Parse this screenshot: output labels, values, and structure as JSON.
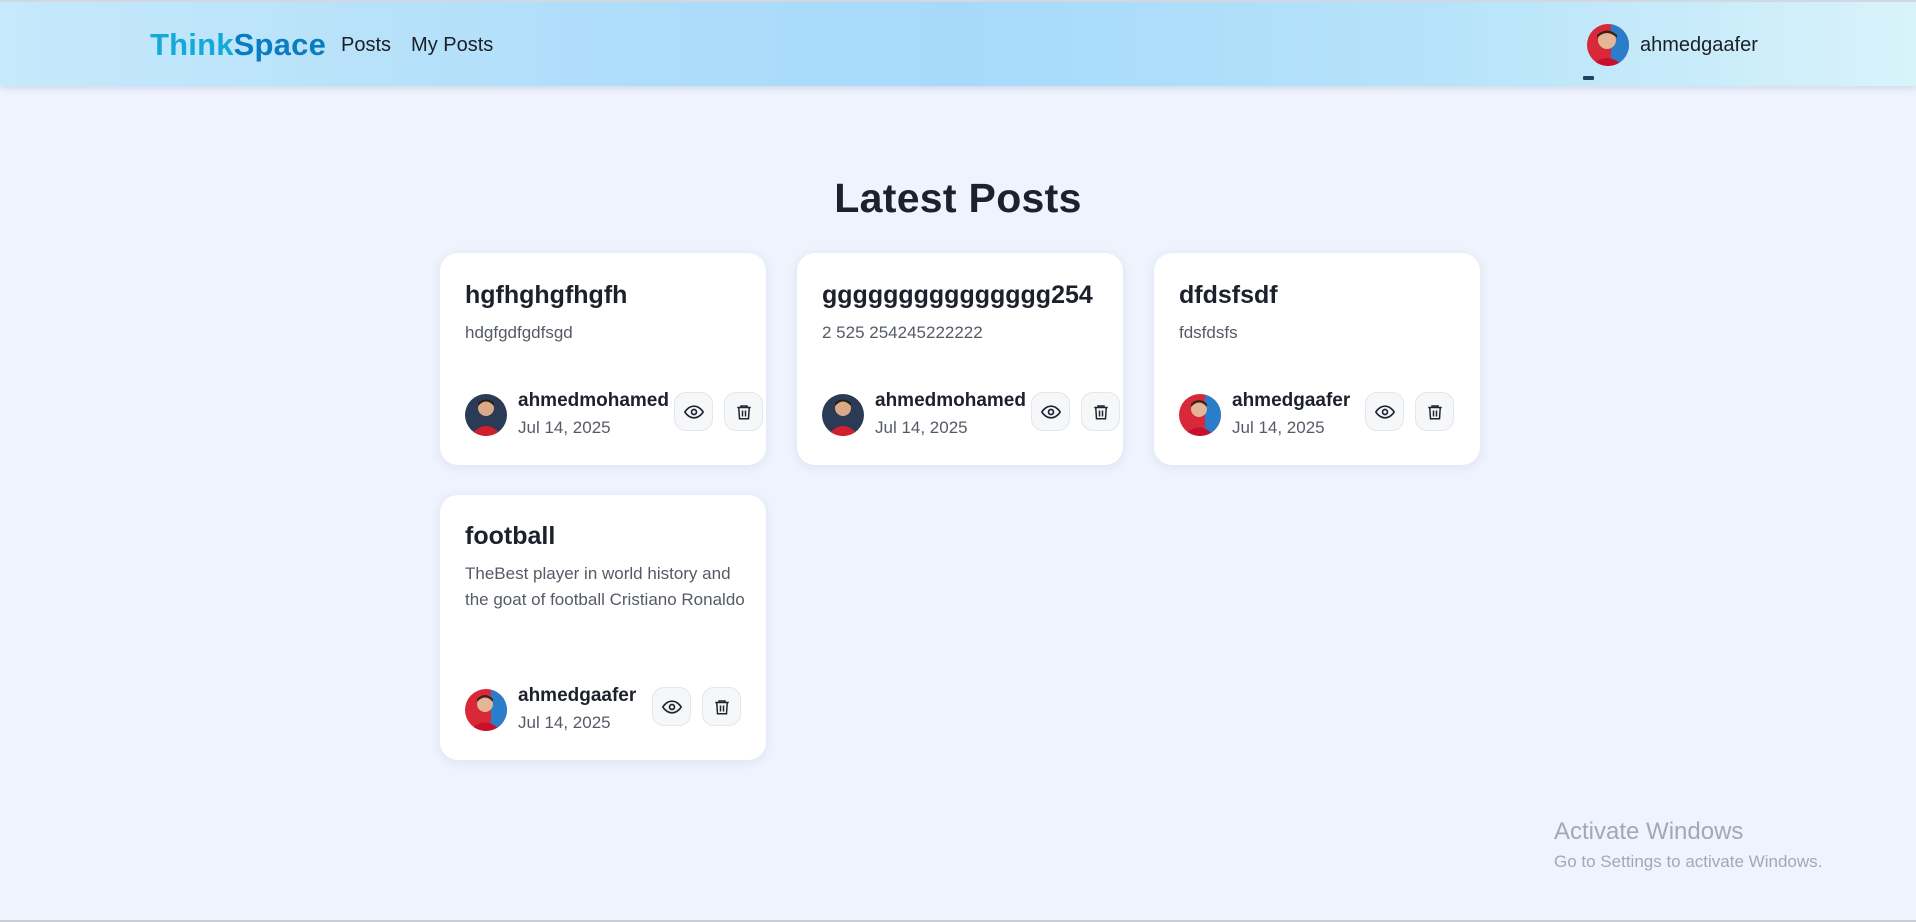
{
  "navbar": {
    "brand_part1": "Think",
    "brand_part2": "Space",
    "links": [
      "Posts",
      "My Posts"
    ],
    "user_name": "ahmedgaafer"
  },
  "page_title": "Latest Posts",
  "posts": [
    {
      "title": "hgfhghgfhgfh",
      "body": "hdgfgdfgdfsgd",
      "author": "ahmedmohamed",
      "date": "Jul 14, 2025"
    },
    {
      "title": "ggggggggggggggg254",
      "body": "2 525 254245222222",
      "author": "ahmedmohamed",
      "date": "Jul 14, 2025"
    },
    {
      "title": "dfdsfsdf",
      "body": "fdsfdsfs",
      "author": "ahmedgaafer",
      "date": "Jul 14, 2025"
    },
    {
      "title": "football",
      "body": "TheBest player in world history and the goat of football Cristiano Ronaldo",
      "author": "ahmedgaafer",
      "date": "Jul 14, 2025"
    }
  ],
  "watermark": {
    "line1": "Activate Windows",
    "line2": "Go to Settings to activate Windows."
  },
  "colors": {
    "brand_light": "#14a9d8",
    "brand_dark": "#0a7cc2",
    "page_background": "#eef3fd",
    "card_background": "#ffffff"
  },
  "icons": [
    "eye-icon",
    "trash-icon"
  ]
}
